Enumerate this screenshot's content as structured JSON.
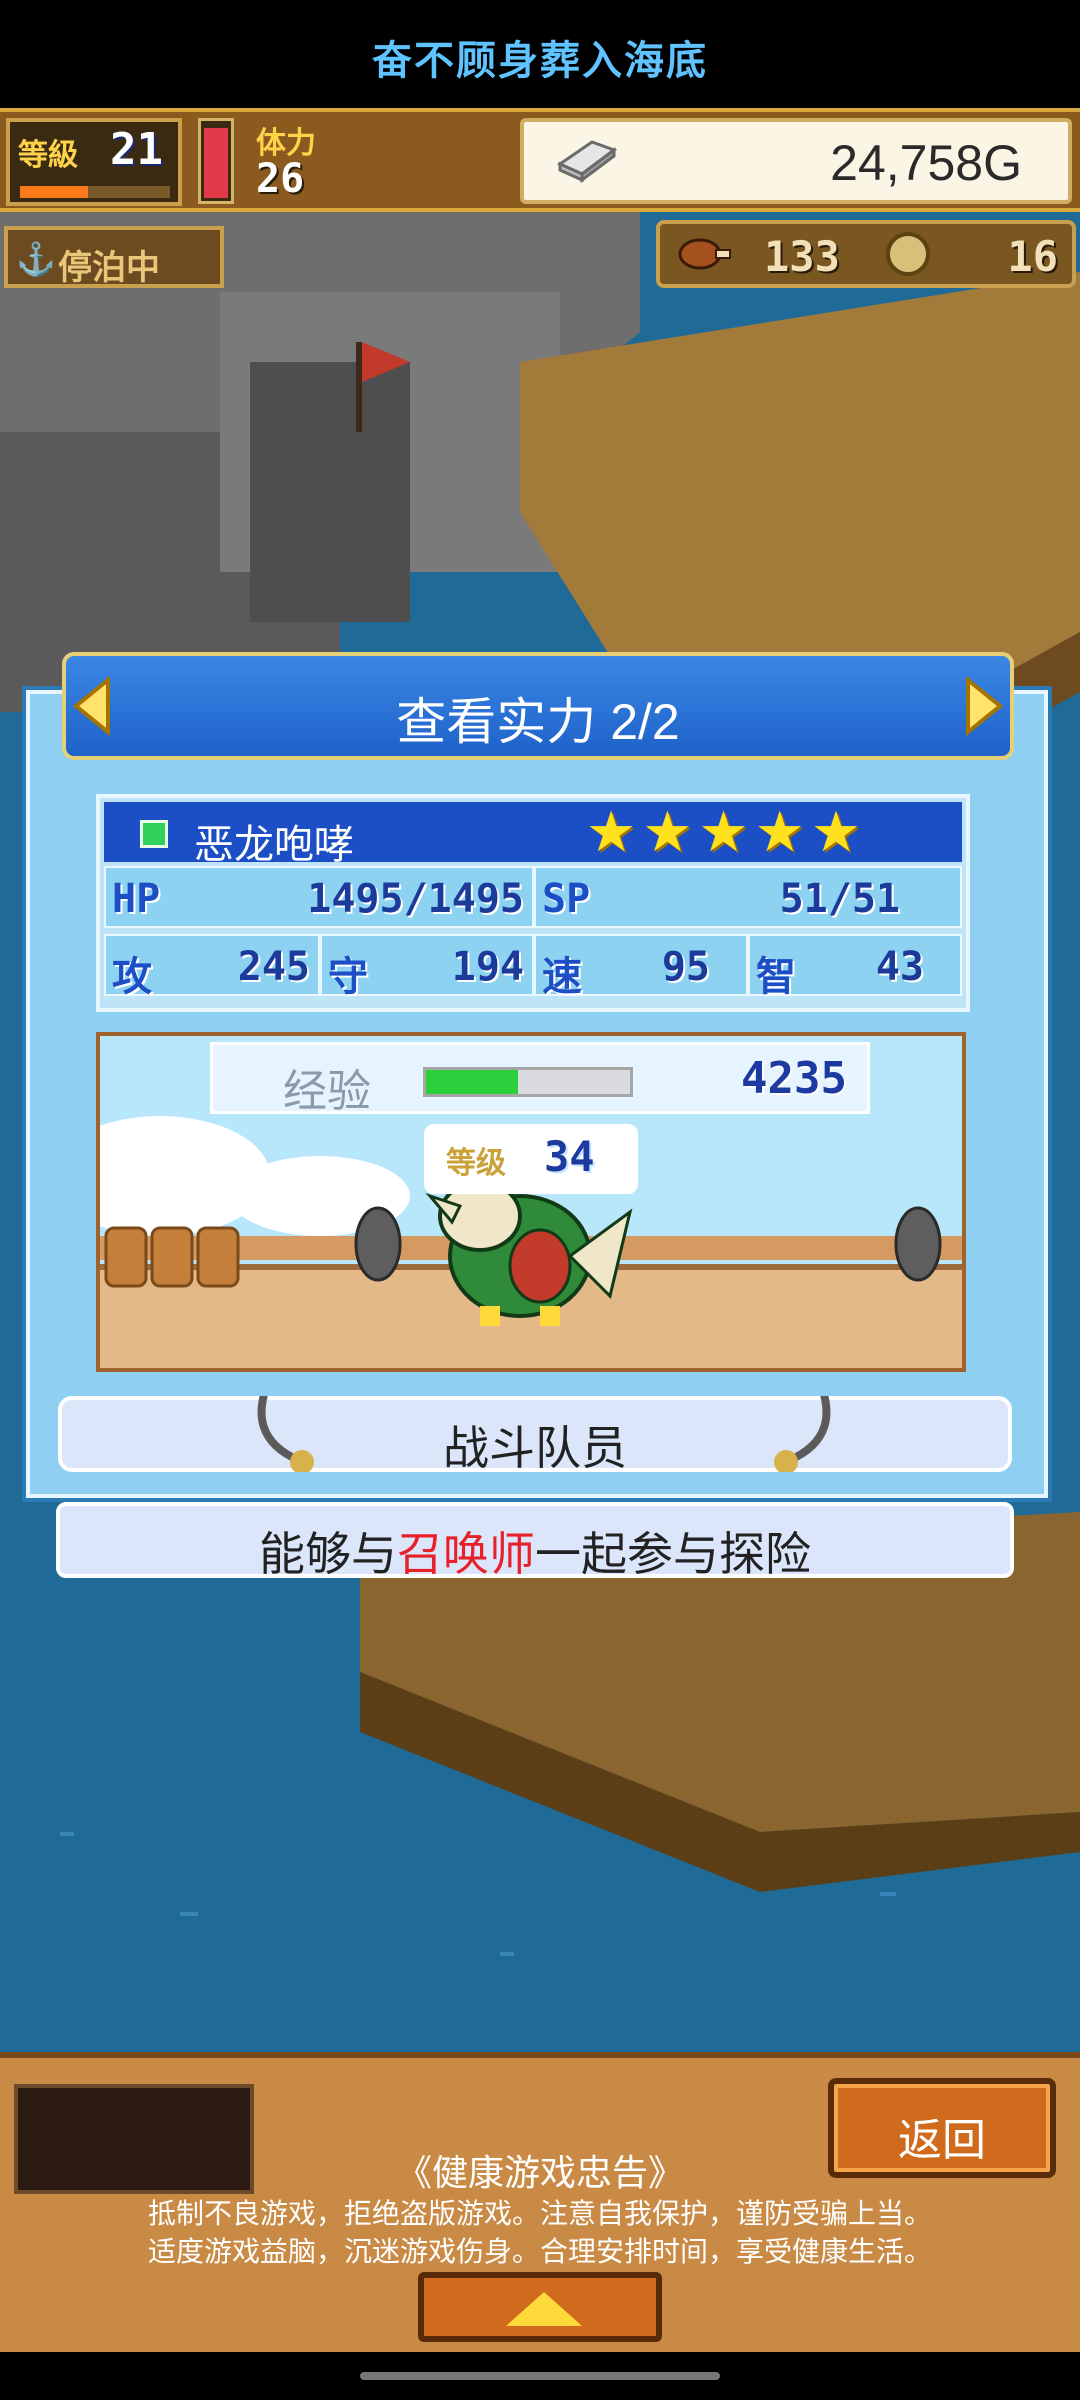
{
  "header": {
    "title": "奋不顾身葬入海底"
  },
  "status": {
    "level_label": "等級",
    "level_value": "21",
    "level_progress": 0.45,
    "stamina_label": "体力",
    "stamina_value": "26",
    "stamina_fill": 0.95,
    "gold": "24,758G",
    "anchor_label": "停泊中",
    "food": "133",
    "coins": "16"
  },
  "panel": {
    "title": "查看实力 2/2",
    "name": "恶龙咆哮",
    "stars": 5,
    "hp_label": "HP",
    "hp": "1495/1495",
    "sp_label": "SP",
    "sp": "51/51",
    "atk_label": "攻",
    "atk": "245",
    "def_label": "守",
    "def": "194",
    "spd_label": "速",
    "spd": "95",
    "int_label": "智",
    "int": "43",
    "exp_label": "经验",
    "exp_value": "4235",
    "exp_progress": 0.45,
    "lv_label": "等级",
    "lv_value": "34",
    "role": "战斗队员",
    "desc_prefix": "能够与",
    "desc_highlight": "召唤师",
    "desc_suffix": "一起参与探险"
  },
  "bottom": {
    "back_label": "返回",
    "notice_title": "《健康游戏忠告》",
    "notice_line1": "抵制不良游戏，拒绝盗版游戏。注意自我保护，谨防受骗上当。",
    "notice_line2": "适度游戏益脑，沉迷游戏伤身。合理安排时间，享受健康生活。"
  },
  "colors": {
    "accent_blue": "#1c4fc5",
    "highlight_red": "#e8202a",
    "gold_yellow": "#ffe11e",
    "exp_green": "#2ad13d"
  }
}
